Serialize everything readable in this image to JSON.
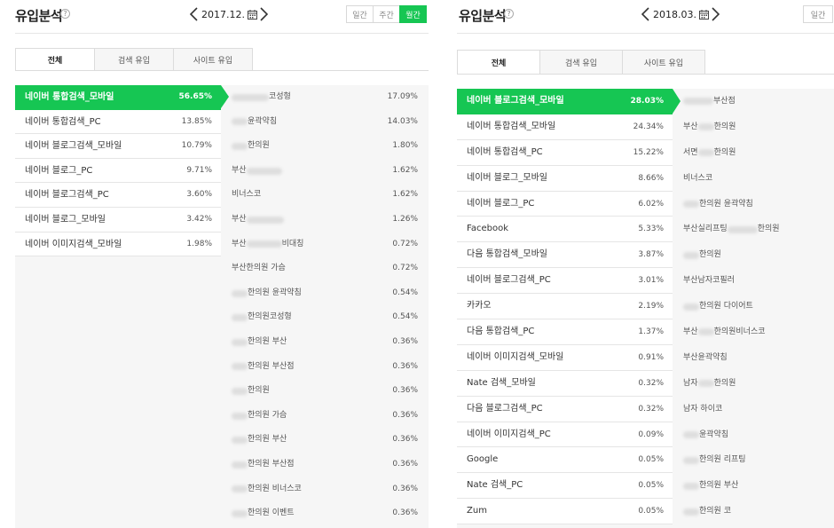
{
  "left": {
    "title": "유입분석",
    "help": "?",
    "date": "2017.12.",
    "period_buttons": [
      {
        "label": "일간",
        "active": false
      },
      {
        "label": "주간",
        "active": false
      },
      {
        "label": "월간",
        "active": true
      }
    ],
    "tabs": [
      {
        "label": "전체",
        "active": true
      },
      {
        "label": "검색 유입",
        "active": false
      },
      {
        "label": "사이트 유입",
        "active": false
      }
    ],
    "sources": [
      {
        "label": "네이버 통합검색_모바일",
        "pct": "56.65%",
        "selected": true
      },
      {
        "label": "네이버 통합검색_PC",
        "pct": "13.85%"
      },
      {
        "label": "네이버 블로그검색_모바일",
        "pct": "10.79%"
      },
      {
        "label": "네이버 블로그_PC",
        "pct": "9.71%"
      },
      {
        "label": "네이버 블로그검색_PC",
        "pct": "3.60%"
      },
      {
        "label": "네이버 블로그_모바일",
        "pct": "3.42%"
      },
      {
        "label": "네이버 이미지검색_모바일",
        "pct": "1.98%"
      }
    ],
    "keywords": [
      {
        "pre": "",
        "blur": 42,
        "post": "코성형",
        "pct": "17.09%"
      },
      {
        "pre": "",
        "blur": 18,
        "post": "윤곽약침",
        "pct": "14.03%"
      },
      {
        "pre": "",
        "blur": 18,
        "post": "한의원",
        "pct": "1.80%"
      },
      {
        "pre": "부산",
        "blur": 40,
        "post": "",
        "pct": "1.62%"
      },
      {
        "pre": "비너스코",
        "blur": 0,
        "post": "",
        "pct": "1.62%"
      },
      {
        "pre": "부산",
        "blur": 42,
        "post": "",
        "pct": "1.26%"
      },
      {
        "pre": "부산",
        "blur": 40,
        "post": "비대칭",
        "pct": "0.72%"
      },
      {
        "pre": "부산한의원 가슴",
        "blur": 0,
        "post": "",
        "pct": "0.72%"
      },
      {
        "pre": "",
        "blur": 18,
        "post": "한의원 윤곽약침",
        "pct": "0.54%"
      },
      {
        "pre": "",
        "blur": 18,
        "post": "한의원코성형",
        "pct": "0.54%"
      },
      {
        "pre": "",
        "blur": 18,
        "post": "한의원 부산",
        "pct": "0.36%"
      },
      {
        "pre": "",
        "blur": 18,
        "post": "한의원 부산점",
        "pct": "0.36%"
      },
      {
        "pre": "",
        "blur": 18,
        "post": "한의원",
        "pct": "0.36%"
      },
      {
        "pre": "",
        "blur": 18,
        "post": "한의원 가슴",
        "pct": "0.36%"
      },
      {
        "pre": "",
        "blur": 18,
        "post": "한의원 부산",
        "pct": "0.36%"
      },
      {
        "pre": "",
        "blur": 18,
        "post": "한의원 부산점",
        "pct": "0.36%"
      },
      {
        "pre": "",
        "blur": 18,
        "post": "한의원 비너스코",
        "pct": "0.36%"
      },
      {
        "pre": "",
        "blur": 18,
        "post": "한의원 이벤트",
        "pct": "0.36%"
      }
    ]
  },
  "right": {
    "title": "유입분석",
    "help": "?",
    "date": "2018.03.",
    "period_buttons": [
      {
        "label": "일간",
        "active": false
      }
    ],
    "tabs": [
      {
        "label": "전체",
        "active": true
      },
      {
        "label": "검색 유입",
        "active": false
      },
      {
        "label": "사이트 유입",
        "active": false
      }
    ],
    "sources": [
      {
        "label": "네이버 블로그검색_모바일",
        "pct": "28.03%",
        "selected": true
      },
      {
        "label": "네이버 통합검색_모바일",
        "pct": "24.34%"
      },
      {
        "label": "네이버 통합검색_PC",
        "pct": "15.22%"
      },
      {
        "label": "네이버 블로그_모바일",
        "pct": "8.66%"
      },
      {
        "label": "네이버 블로그_PC",
        "pct": "6.02%"
      },
      {
        "label": "Facebook",
        "pct": "5.33%"
      },
      {
        "label": "다음 통합검색_모바일",
        "pct": "3.87%"
      },
      {
        "label": "네이버 블로그검색_PC",
        "pct": "3.01%"
      },
      {
        "label": "카카오",
        "pct": "2.19%"
      },
      {
        "label": "다음 통합검색_PC",
        "pct": "1.37%"
      },
      {
        "label": "네이버 이미지검색_모바일",
        "pct": "0.91%"
      },
      {
        "label": "Nate 검색_모바일",
        "pct": "0.32%"
      },
      {
        "label": "다음 블로그검색_PC",
        "pct": "0.32%"
      },
      {
        "label": "네이버 이미지검색_PC",
        "pct": "0.09%"
      },
      {
        "label": "Google",
        "pct": "0.05%"
      },
      {
        "label": "Nate 검색_PC",
        "pct": "0.05%"
      },
      {
        "label": "Zum",
        "pct": "0.05%"
      }
    ],
    "keywords": [
      {
        "pre": "",
        "blur": 34,
        "post": "부산점",
        "pct": ""
      },
      {
        "pre": "부산",
        "blur": 18,
        "post": "한의원",
        "pct": ""
      },
      {
        "pre": "서면",
        "blur": 18,
        "post": "한의원",
        "pct": ""
      },
      {
        "pre": "비너스코",
        "blur": 0,
        "post": "",
        "pct": ""
      },
      {
        "pre": "",
        "blur": 18,
        "post": "한의원 윤곽약침",
        "pct": ""
      },
      {
        "pre": "부산실리프팅",
        "blur": 34,
        "post": "한의원",
        "pct": ""
      },
      {
        "pre": "",
        "blur": 18,
        "post": "한의원",
        "pct": ""
      },
      {
        "pre": "부산남자코필러",
        "blur": 0,
        "post": "",
        "pct": ""
      },
      {
        "pre": "",
        "blur": 18,
        "post": "한의원 다이어트",
        "pct": ""
      },
      {
        "pre": "부산",
        "blur": 18,
        "post": "한의원비너스코",
        "pct": ""
      },
      {
        "pre": "부산윤곽약침",
        "blur": 0,
        "post": "",
        "pct": ""
      },
      {
        "pre": "남자",
        "blur": 18,
        "post": "한의원",
        "pct": ""
      },
      {
        "pre": "남자 하이코",
        "blur": 0,
        "post": "",
        "pct": ""
      },
      {
        "pre": "",
        "blur": 18,
        "post": "윤곽약침",
        "pct": ""
      },
      {
        "pre": "",
        "blur": 18,
        "post": "한의원 리프팅",
        "pct": ""
      },
      {
        "pre": "",
        "blur": 18,
        "post": "한의원 부산",
        "pct": ""
      },
      {
        "pre": "",
        "blur": 18,
        "post": "한의원 코",
        "pct": ""
      }
    ]
  }
}
